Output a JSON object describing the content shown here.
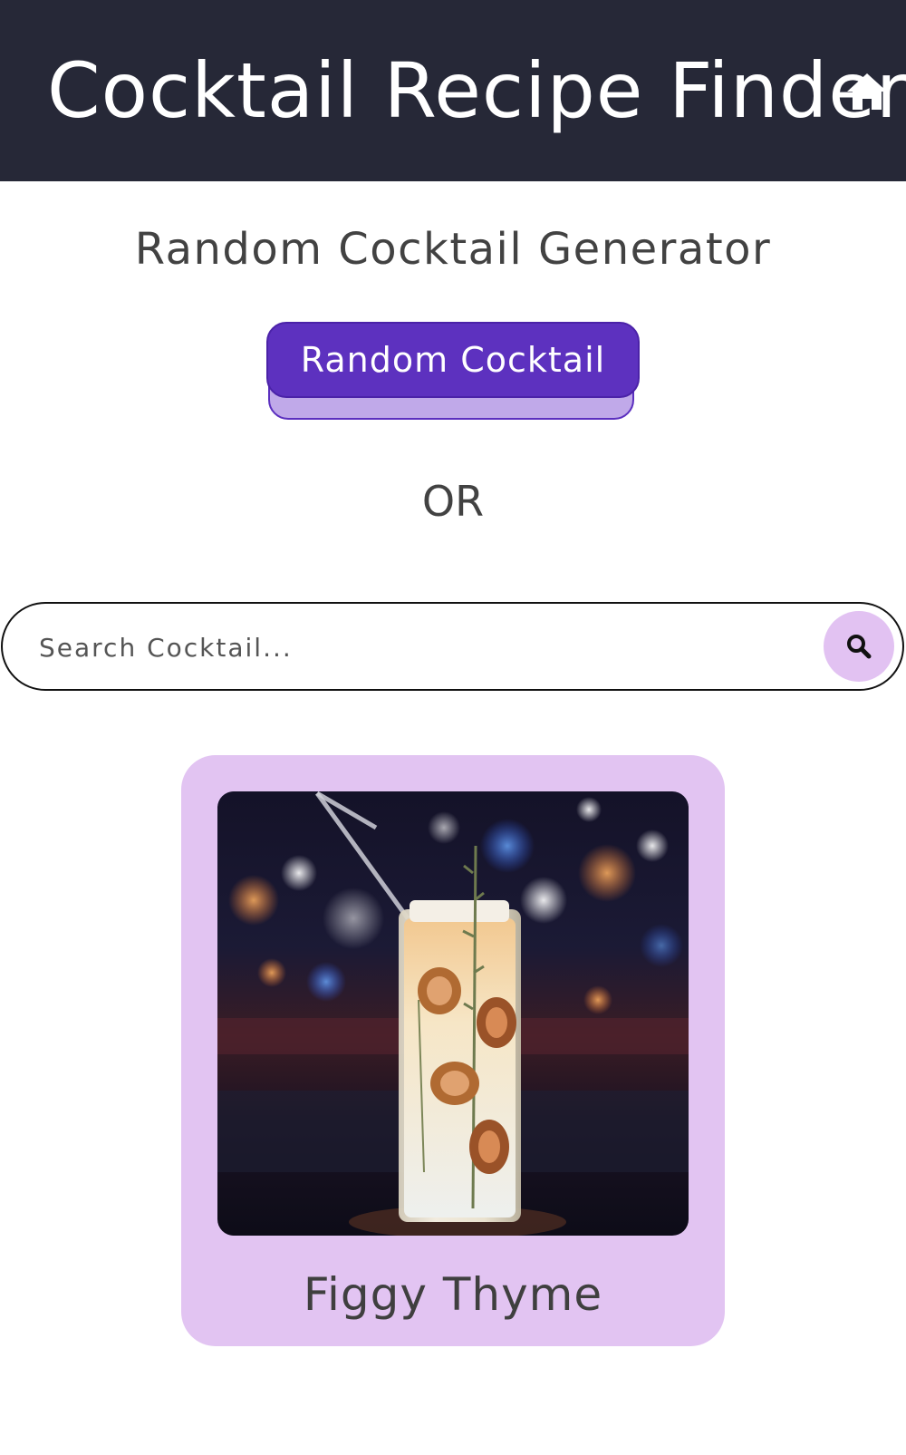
{
  "header": {
    "title": "Cocktail Recipe Finder",
    "home_icon": "home-icon",
    "background": "#262837"
  },
  "random_section": {
    "heading": "Random Cocktail Generator",
    "button_label": "Random Cocktail",
    "button_color": "#5d31bf"
  },
  "divider_text": "OR",
  "search": {
    "placeholder": "Search Cocktail...",
    "value": "",
    "button_icon": "search-icon"
  },
  "result_card": {
    "name": "Figgy Thyme",
    "image": "tall glass cocktail with fig slices and thyme sprigs",
    "background": "#e2c4f2"
  }
}
